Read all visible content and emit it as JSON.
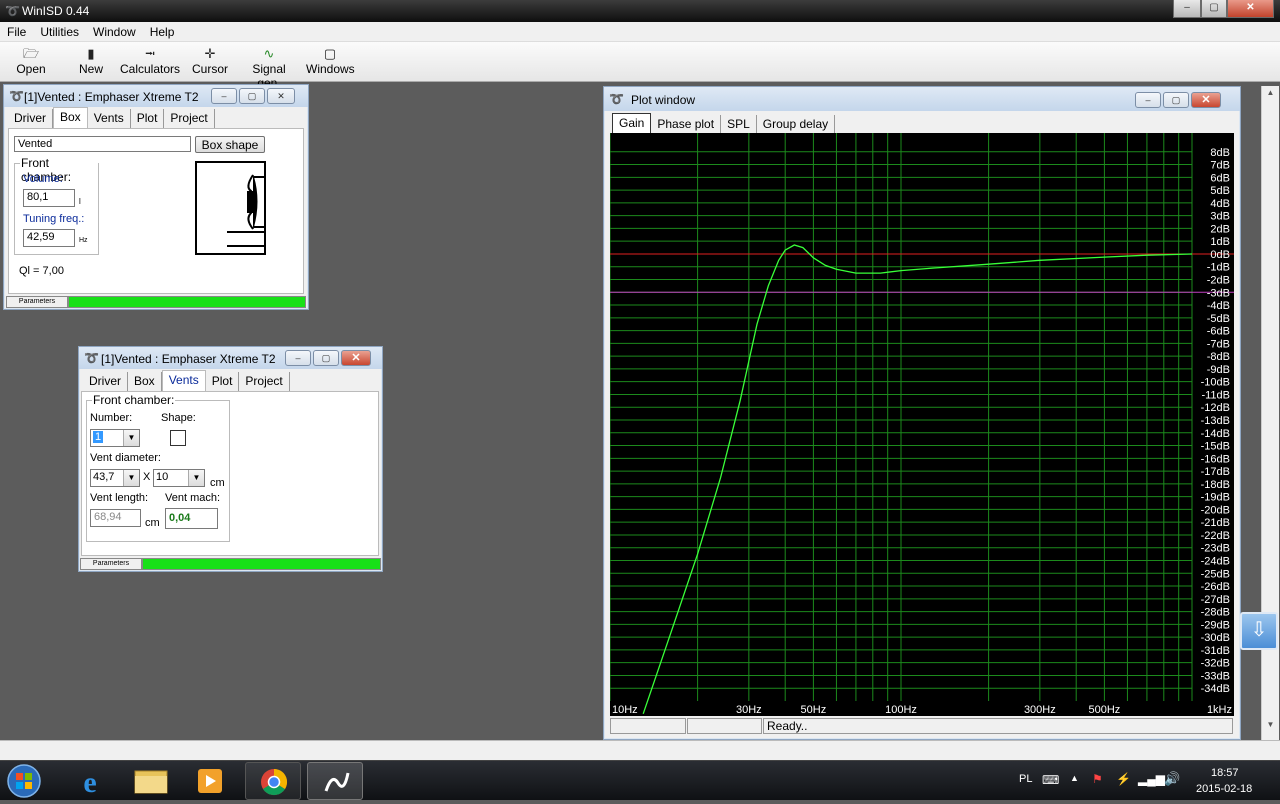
{
  "app": {
    "title": "WinISD 0.44"
  },
  "menu": [
    "File",
    "Utilities",
    "Window",
    "Help"
  ],
  "toolbar": [
    {
      "label": "Open",
      "icon": "open-icon"
    },
    {
      "label": "New",
      "icon": "new-icon"
    },
    {
      "label": "Calculators",
      "icon": "calculators-icon"
    },
    {
      "label": "Cursor",
      "icon": "cursor-icon"
    },
    {
      "label": "Signal gen.",
      "icon": "signal-gen-icon"
    },
    {
      "label": "Windows",
      "icon": "windows-icon"
    }
  ],
  "box_window": {
    "title": "[1]Vented : Emphaser Xtreme T2",
    "tabs": [
      "Driver",
      "Box",
      "Vents",
      "Plot",
      "Project"
    ],
    "active_tab": "Box",
    "box_type": "Vented",
    "box_shape_button": "Box shape",
    "group_label": "Front chamber:",
    "volume_label": "Volume:",
    "volume_value": "80,1",
    "volume_unit": "l",
    "tuning_label": "Tuning freq.:",
    "tuning_value": "42,59",
    "tuning_unit": "Hz",
    "ql": "Ql = 7,00",
    "status_label": "Parameters"
  },
  "vents_window": {
    "title": "[1]Vented : Emphaser Xtreme T2",
    "tabs": [
      "Driver",
      "Box",
      "Vents",
      "Plot",
      "Project"
    ],
    "active_tab": "Vents",
    "group_label": "Front chamber:",
    "number_label": "Number:",
    "number_value": "1",
    "shape_label": "Shape:",
    "diameter_label": "Vent diameter:",
    "diameter_value": "43,7",
    "times": "X",
    "diameter_value2": "10",
    "diameter_unit": "cm",
    "length_label": "Vent length:",
    "length_value": "68,94",
    "length_unit": "cm",
    "mach_label": "Vent mach:",
    "mach_value": "0,04",
    "status_label": "Parameters"
  },
  "plot_window": {
    "title": "Plot window",
    "tabs": [
      "Gain",
      "Phase plot",
      "SPL",
      "Group delay"
    ],
    "active_tab": "Gain",
    "status": "Ready.."
  },
  "chart_data": {
    "type": "line",
    "title": "",
    "xlabel": "",
    "ylabel": "",
    "x_scale": "log",
    "xlim": [
      10,
      1000
    ],
    "ylim": [
      -35,
      9
    ],
    "x_tick_labels": [
      {
        "label": "10Hz",
        "value": 10
      },
      {
        "label": "30Hz",
        "value": 30
      },
      {
        "label": "50Hz",
        "value": 50
      },
      {
        "label": "100Hz",
        "value": 100
      },
      {
        "label": "300Hz",
        "value": 300
      },
      {
        "label": "500Hz",
        "value": 500
      },
      {
        "label": "1kHz",
        "value": 1000
      }
    ],
    "y_ticks": [
      8,
      7,
      6,
      5,
      4,
      3,
      2,
      1,
      0,
      -1,
      -2,
      -3,
      -4,
      -5,
      -6,
      -7,
      -8,
      -9,
      -10,
      -11,
      -12,
      -13,
      -14,
      -15,
      -16,
      -17,
      -18,
      -19,
      -20,
      -21,
      -22,
      -23,
      -24,
      -25,
      -26,
      -27,
      -28,
      -29,
      -30,
      -31,
      -32,
      -33,
      -34
    ],
    "y_unit": "dB",
    "grid": true,
    "reference_lines": [
      {
        "y": 0,
        "color": "#e02020"
      },
      {
        "y": -3,
        "color": "#c040c0"
      }
    ],
    "series": [
      {
        "color": "#39ff39",
        "x": [
          13.0,
          16.0,
          20.0,
          24.0,
          28.0,
          32.0,
          35.0,
          38.0,
          40.0,
          43.0,
          46.0,
          50.0,
          55.0,
          60.0,
          70.0,
          85.0,
          100.0,
          130.0,
          200.0,
          300.0,
          500.0,
          700.0,
          1000.0
        ],
        "y": [
          -36.0,
          -30.0,
          -23.5,
          -17.5,
          -11.5,
          -5.5,
          -2.5,
          -0.5,
          0.3,
          0.7,
          0.5,
          -0.3,
          -0.9,
          -1.2,
          -1.5,
          -1.5,
          -1.3,
          -1.1,
          -0.8,
          -0.5,
          -0.25,
          -0.1,
          0.0
        ]
      }
    ]
  },
  "taskbar": {
    "apps": [
      "start-orb-icon",
      "internet-explorer-icon",
      "file-explorer-icon",
      "media-player-icon",
      "chrome-icon",
      "winisd-icon"
    ],
    "lang": "PL",
    "time": "18:57",
    "date": "2015-02-18"
  }
}
